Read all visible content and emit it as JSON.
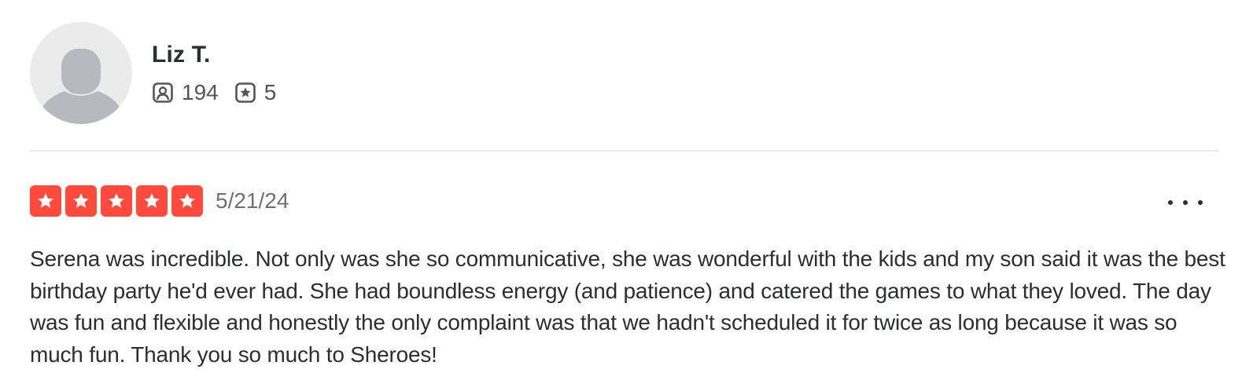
{
  "user": {
    "name": "Liz T.",
    "avatar_icon": "default-user-avatar",
    "stats": {
      "friends_count": "194",
      "friends_icon": "friends-icon",
      "reviews_count": "5",
      "reviews_icon": "review-star-icon"
    }
  },
  "review": {
    "rating": 5,
    "rating_max": 5,
    "star_color": "#ff4b3e",
    "date": "5/21/24",
    "more_options_icon": "more-options-icon",
    "text": "Serena was incredible. Not only was she so communicative, she was wonderful with the kids and my son said it was the best birthday party he'd ever had. She had boundless energy (and patience) and catered the games to what they loved. The day was fun and flexible and honestly the only complaint was that we hadn't scheduled it for twice as long because it was so much fun. Thank you so much to Sheroes!"
  }
}
